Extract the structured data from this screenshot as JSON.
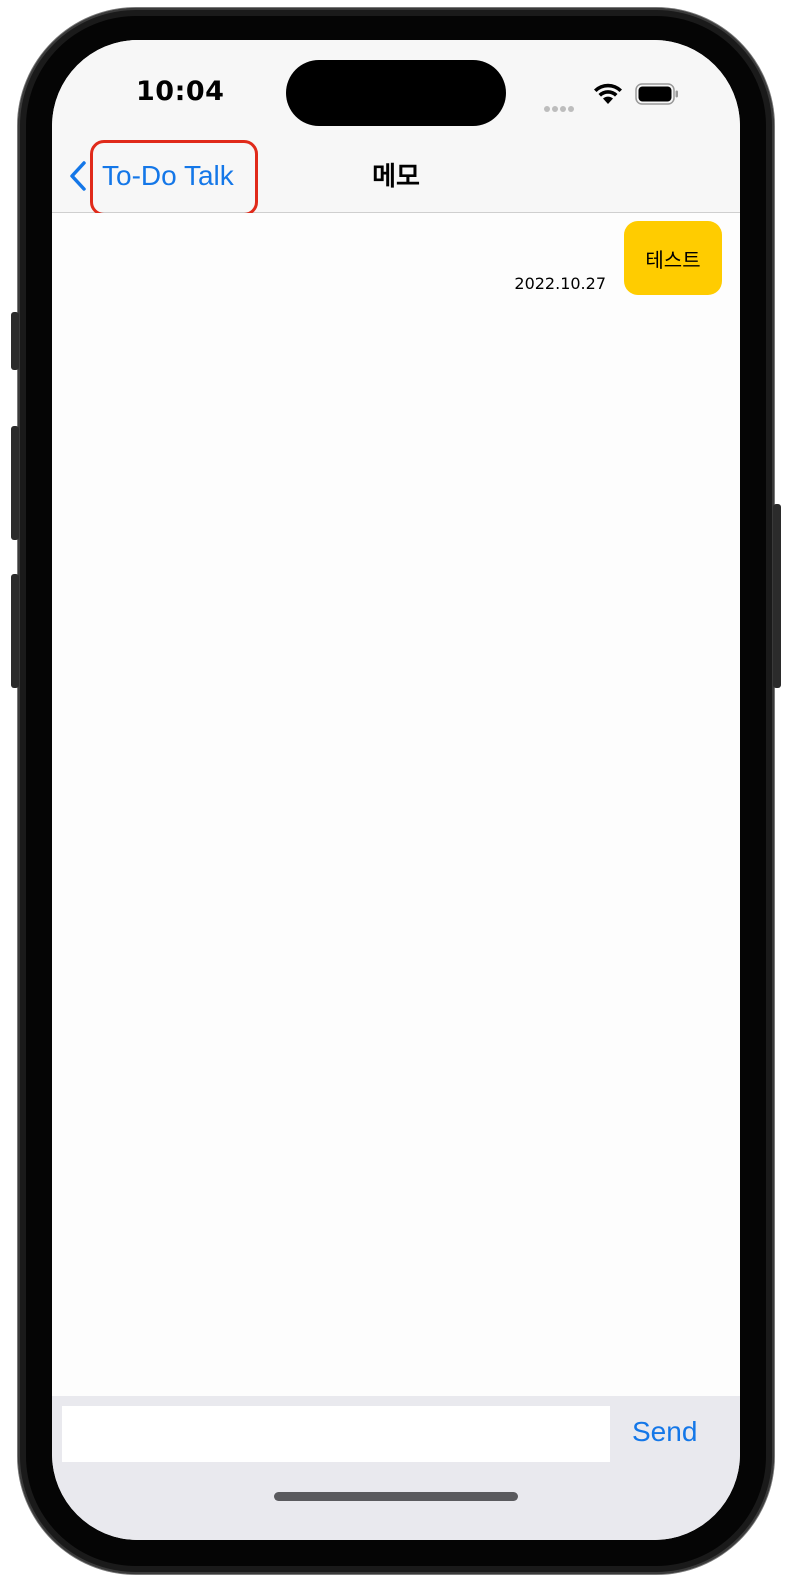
{
  "status_bar": {
    "time": "10:04",
    "icons": [
      "cellular-icon",
      "wifi-icon",
      "battery-icon"
    ]
  },
  "nav_bar": {
    "back_label": "To-Do Talk",
    "title": "메모",
    "back_icon": "chevron-left-icon"
  },
  "messages": [
    {
      "text": "테스트",
      "date": "2022.10.27"
    }
  ],
  "input_bar": {
    "value": "",
    "placeholder": "",
    "send_label": "Send"
  },
  "colors": {
    "accent": "#1477e8",
    "bubble": "#ffcc00",
    "highlight": "#e02a1a",
    "bar_background": "#f7f7f7",
    "input_bar_background": "#e9e9ee"
  }
}
